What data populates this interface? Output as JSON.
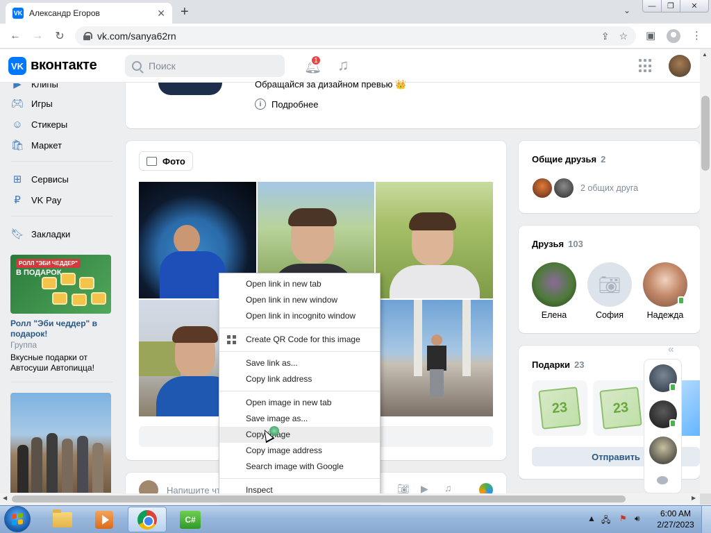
{
  "browser": {
    "tab_title": "Александр Егоров",
    "tab_favicon": "VK",
    "url": "vk.com/sanya62rn",
    "colors": {
      "tabstrip": "#dee1e6",
      "toolbar": "#ffffff"
    }
  },
  "vk": {
    "logo_letter": "VK",
    "brand": "вконтакте",
    "search_placeholder": "Поиск",
    "notification_count": "1",
    "accent": "#0077ff"
  },
  "leftnav": {
    "items": [
      {
        "label": "Клипы",
        "icon": "clips-icon"
      },
      {
        "label": "Игры",
        "icon": "gamepad-icon"
      },
      {
        "label": "Стикеры",
        "icon": "sticker-icon"
      },
      {
        "label": "Маркет",
        "icon": "bag-icon"
      },
      {
        "label": "Сервисы",
        "icon": "services-icon"
      },
      {
        "label": "VK Pay",
        "icon": "ruble-icon"
      },
      {
        "label": "Закладки",
        "icon": "bookmark-icon"
      }
    ],
    "ad": {
      "banner_top": "РОЛЛ \"ЭБИ ЧЕДДЕР\"",
      "banner_big": "В ПОДАРОК",
      "title": "Ролл \"Эби чеддер\" в подарок!",
      "subtitle": "Группа",
      "text": "Вкусные подарки от Автосуши Автопицца!"
    }
  },
  "profile": {
    "status": "Обращайся за дизайном превью 👑",
    "more_label": "Подробнее"
  },
  "photos": {
    "tab_label": "Фото"
  },
  "post": {
    "placeholder": "Напишите что-нибудь..."
  },
  "right": {
    "mutual": {
      "title": "Общие друзья",
      "count": "2",
      "text": "2 общих друга"
    },
    "friends": {
      "title": "Друзья",
      "count": "103",
      "list": [
        {
          "name": "Елена"
        },
        {
          "name": "София"
        },
        {
          "name": "Надежда"
        }
      ]
    },
    "gifts": {
      "title": "Подарки",
      "count": "23",
      "send_label": "Отправить"
    }
  },
  "context_menu": {
    "groups": [
      [
        "Open link in new tab",
        "Open link in new window",
        "Open link in incognito window"
      ],
      [
        "Create QR Code for this image"
      ],
      [
        "Save link as...",
        "Copy link address"
      ],
      [
        "Open image in new tab",
        "Save image as...",
        "Copy image",
        "Copy image address",
        "Search image with Google"
      ],
      [
        "Inspect"
      ]
    ],
    "highlighted": "Copy image"
  },
  "taskbar": {
    "time": "6:00 AM",
    "date": "2/27/2023",
    "apps": [
      "explorer",
      "media-player",
      "chrome",
      "csharp-ide"
    ],
    "csharp_label": "C#"
  }
}
